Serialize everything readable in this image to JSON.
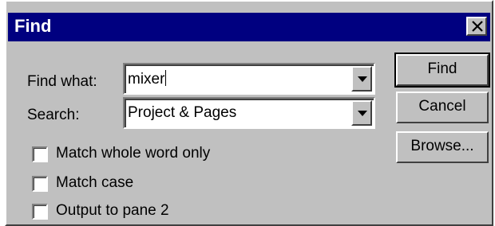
{
  "window": {
    "title": "Find"
  },
  "form": {
    "find_what_label": "Find what:",
    "find_what_value": "mixer",
    "search_label": "Search:",
    "search_value": "Project & Pages"
  },
  "buttons": {
    "find": "Find",
    "cancel": "Cancel",
    "browse": "Browse..."
  },
  "options": [
    {
      "label": "Match whole word only",
      "checked": false
    },
    {
      "label": "Match case",
      "checked": false
    },
    {
      "label": "Output to pane 2",
      "checked": false
    }
  ],
  "colors": {
    "titlebar": "#000080",
    "face": "#c0c0c0"
  },
  "icons": {
    "close": "close-icon",
    "dropdown": "chevron-down-icon"
  }
}
